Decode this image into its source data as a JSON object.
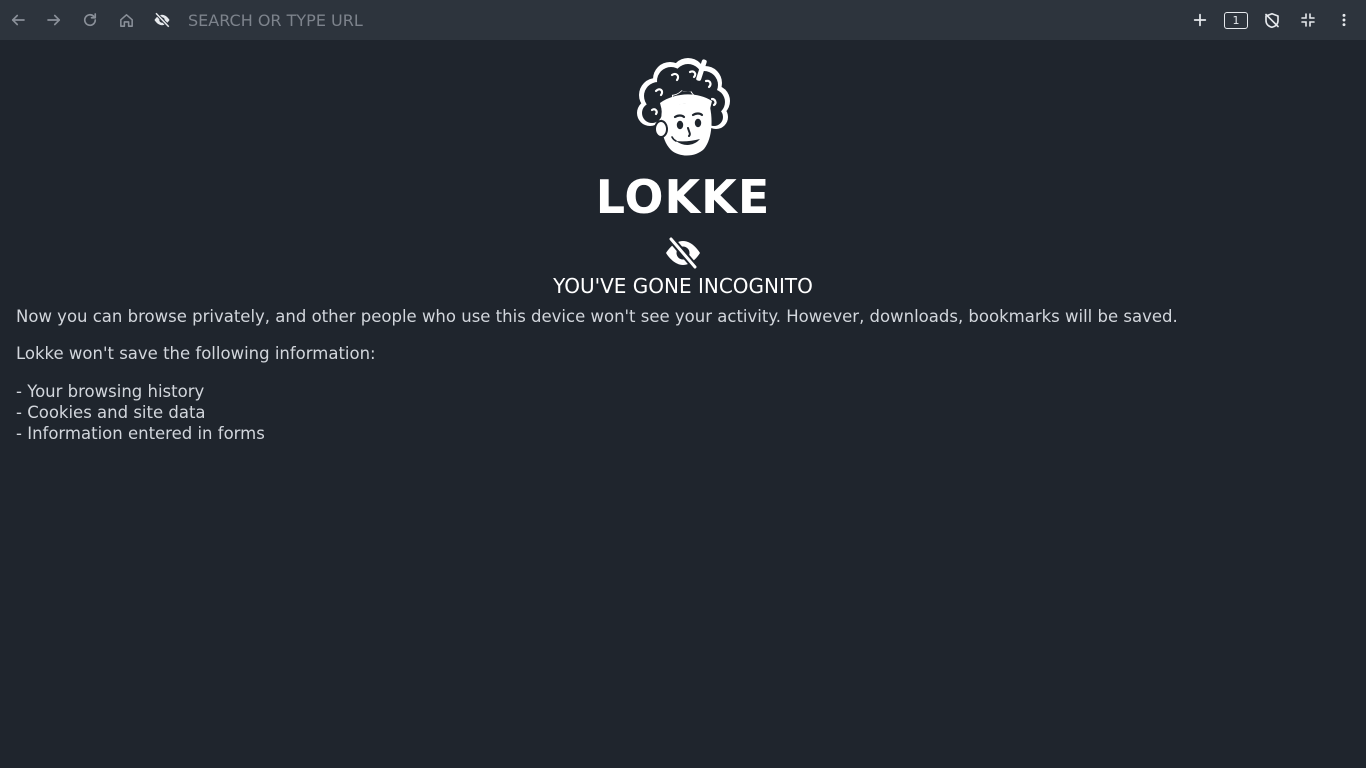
{
  "toolbar": {
    "url_placeholder": "SEARCH OR TYPE URL",
    "tab_count": "1",
    "icons": [
      "arrow-left-icon",
      "arrow-right-icon",
      "reload-icon",
      "home-icon",
      "incognito-eye-off-icon",
      "plus-icon",
      "tab-count-icon",
      "shield-off-icon",
      "collapse-icon",
      "more-vertical-icon"
    ]
  },
  "page": {
    "brand": "LOKKE",
    "heading": "YOU'VE GONE INCOGNITO",
    "intro": "Now you can browse privately, and other people who use this device won't see your activity. However, downloads, bookmarks will be saved.",
    "not_saved_title": "Lokke won't save the following information:",
    "not_saved_items": [
      "- Your browsing history",
      "- Cookies and site data",
      "- Information entered in forms"
    ]
  },
  "colors": {
    "background": "#1f252d",
    "toolbar": "#2d343d",
    "text": "#d2d6dc",
    "heading": "#ffffff"
  }
}
